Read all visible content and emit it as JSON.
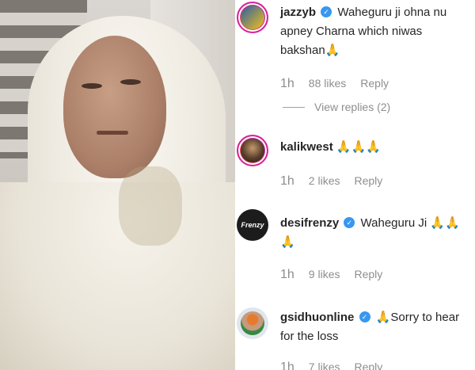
{
  "comments": [
    {
      "username": "jazzyb",
      "verified": true,
      "text": "Waheguru ji ohna nu apney Charna which niwas bakshan",
      "emoji": "🙏",
      "time": "1h",
      "likes": "88 likes",
      "reply": "Reply",
      "view_replies": "View replies (2)",
      "avatar_icon": "jazzyb-avatar"
    },
    {
      "username": "kalikwest",
      "verified": false,
      "text": "",
      "emoji": "🙏🙏🙏",
      "time": "1h",
      "likes": "2 likes",
      "reply": "Reply",
      "avatar_icon": "kalikwest-avatar"
    },
    {
      "username": "desifrenzy",
      "verified": true,
      "text": "Waheguru Ji",
      "emoji": "🙏🙏🙏",
      "time": "1h",
      "likes": "9 likes",
      "reply": "Reply",
      "avatar_label": "Frenzy",
      "avatar_icon": "desifrenzy-avatar"
    },
    {
      "username": "gsidhuonline",
      "verified": true,
      "text": "Sorry to hear for the loss",
      "emoji": "🙏",
      "time": "1h",
      "likes": "7 likes",
      "reply": "Reply",
      "avatar_icon": "gsidhuonline-avatar"
    }
  ],
  "colors": {
    "verified": "#3897f0",
    "meta": "#8e8e8e",
    "text": "#262626",
    "story_ring": "#d6249f"
  }
}
